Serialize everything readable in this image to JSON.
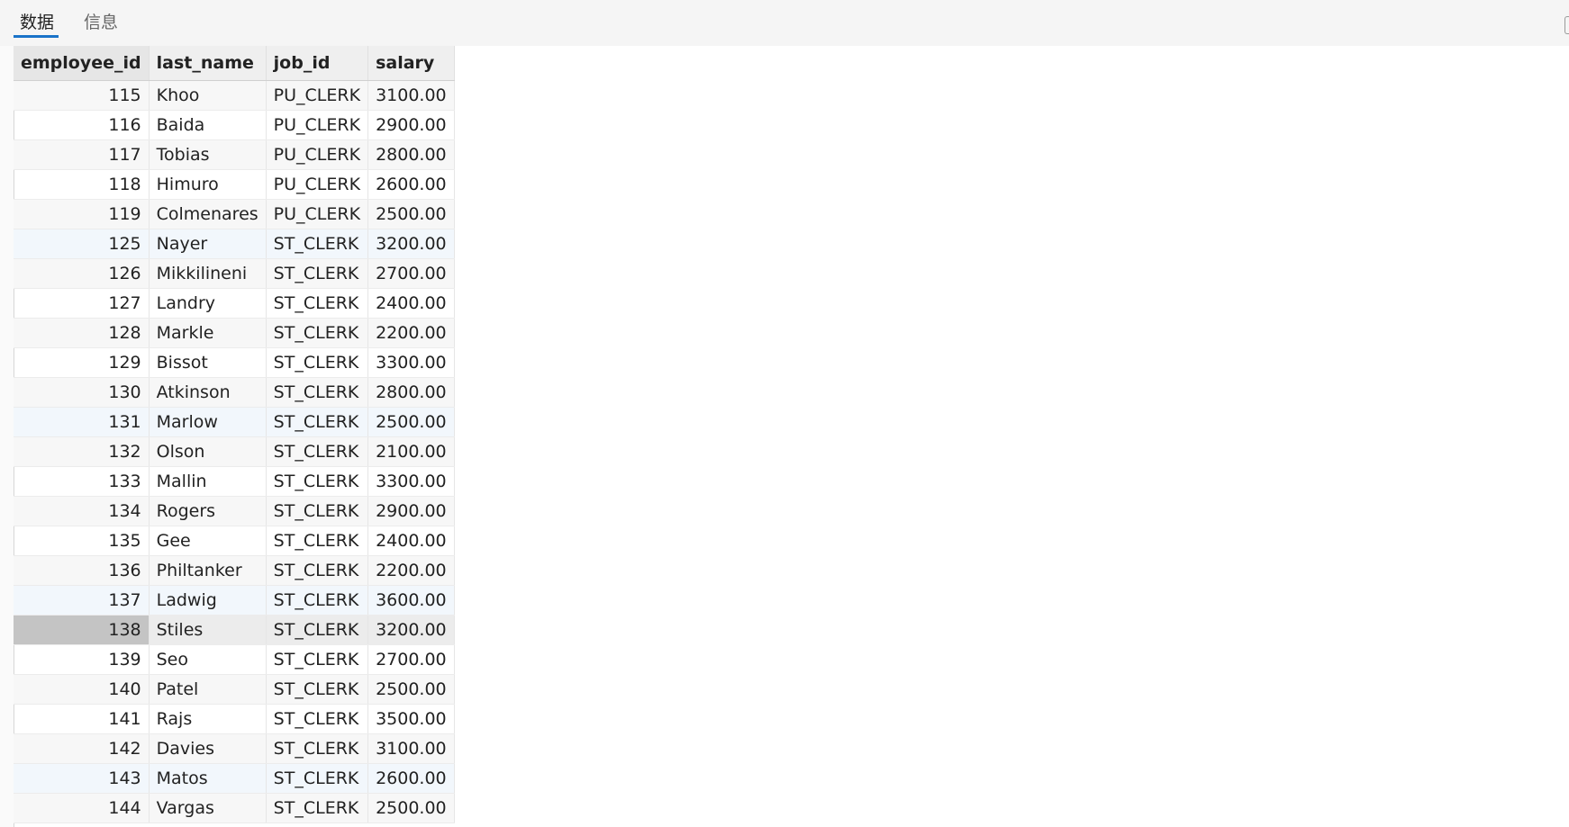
{
  "tabs": [
    {
      "label": "数据",
      "active": true
    },
    {
      "label": "信息",
      "active": false
    }
  ],
  "accent_color": "#1a73c8",
  "columns": [
    "employee_id",
    "last_name",
    "job_id",
    "salary"
  ],
  "rows": [
    {
      "employee_id": "115",
      "last_name": "Khoo",
      "job_id": "PU_CLERK",
      "salary": "3100.00"
    },
    {
      "employee_id": "116",
      "last_name": "Baida",
      "job_id": "PU_CLERK",
      "salary": "2900.00"
    },
    {
      "employee_id": "117",
      "last_name": "Tobias",
      "job_id": "PU_CLERK",
      "salary": "2800.00"
    },
    {
      "employee_id": "118",
      "last_name": "Himuro",
      "job_id": "PU_CLERK",
      "salary": "2600.00"
    },
    {
      "employee_id": "119",
      "last_name": "Colmenares",
      "job_id": "PU_CLERK",
      "salary": "2500.00"
    },
    {
      "employee_id": "125",
      "last_name": "Nayer",
      "job_id": "ST_CLERK",
      "salary": "3200.00"
    },
    {
      "employee_id": "126",
      "last_name": "Mikkilineni",
      "job_id": "ST_CLERK",
      "salary": "2700.00"
    },
    {
      "employee_id": "127",
      "last_name": "Landry",
      "job_id": "ST_CLERK",
      "salary": "2400.00"
    },
    {
      "employee_id": "128",
      "last_name": "Markle",
      "job_id": "ST_CLERK",
      "salary": "2200.00"
    },
    {
      "employee_id": "129",
      "last_name": "Bissot",
      "job_id": "ST_CLERK",
      "salary": "3300.00"
    },
    {
      "employee_id": "130",
      "last_name": "Atkinson",
      "job_id": "ST_CLERK",
      "salary": "2800.00"
    },
    {
      "employee_id": "131",
      "last_name": "Marlow",
      "job_id": "ST_CLERK",
      "salary": "2500.00"
    },
    {
      "employee_id": "132",
      "last_name": "Olson",
      "job_id": "ST_CLERK",
      "salary": "2100.00"
    },
    {
      "employee_id": "133",
      "last_name": "Mallin",
      "job_id": "ST_CLERK",
      "salary": "3300.00"
    },
    {
      "employee_id": "134",
      "last_name": "Rogers",
      "job_id": "ST_CLERK",
      "salary": "2900.00"
    },
    {
      "employee_id": "135",
      "last_name": "Gee",
      "job_id": "ST_CLERK",
      "salary": "2400.00"
    },
    {
      "employee_id": "136",
      "last_name": "Philtanker",
      "job_id": "ST_CLERK",
      "salary": "2200.00"
    },
    {
      "employee_id": "137",
      "last_name": "Ladwig",
      "job_id": "ST_CLERK",
      "salary": "3600.00"
    },
    {
      "employee_id": "138",
      "last_name": "Stiles",
      "job_id": "ST_CLERK",
      "salary": "3200.00"
    },
    {
      "employee_id": "139",
      "last_name": "Seo",
      "job_id": "ST_CLERK",
      "salary": "2700.00"
    },
    {
      "employee_id": "140",
      "last_name": "Patel",
      "job_id": "ST_CLERK",
      "salary": "2500.00"
    },
    {
      "employee_id": "141",
      "last_name": "Rajs",
      "job_id": "ST_CLERK",
      "salary": "3500.00"
    },
    {
      "employee_id": "142",
      "last_name": "Davies",
      "job_id": "ST_CLERK",
      "salary": "3100.00"
    },
    {
      "employee_id": "143",
      "last_name": "Matos",
      "job_id": "ST_CLERK",
      "salary": "2600.00"
    },
    {
      "employee_id": "144",
      "last_name": "Vargas",
      "job_id": "ST_CLERK",
      "salary": "2500.00"
    }
  ],
  "selected_employee_id": "138"
}
